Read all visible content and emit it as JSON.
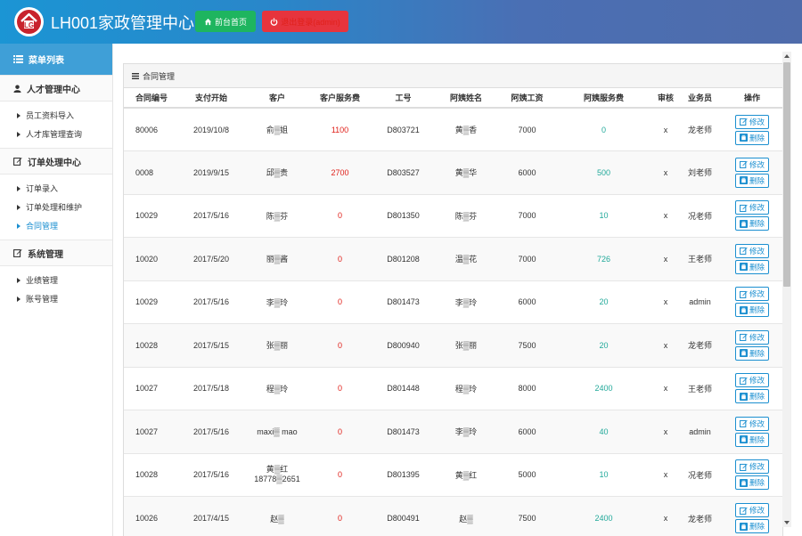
{
  "header": {
    "title": "LH001家政管理中心",
    "home_button": "前台首页",
    "logout_button": "退出登录(admin)"
  },
  "sidebar": {
    "menu_title": "菜单列表",
    "groups": [
      {
        "label": "人才管理中心",
        "icon": "user-icon",
        "items": [
          {
            "label": "员工资料导入",
            "active": false
          },
          {
            "label": "人才库管理查询",
            "active": false
          }
        ]
      },
      {
        "label": "订单处理中心",
        "icon": "edit-icon",
        "items": [
          {
            "label": "订单录入",
            "active": false
          },
          {
            "label": "订单处理和维护",
            "active": false
          },
          {
            "label": "合同管理",
            "active": true
          }
        ]
      },
      {
        "label": "系统管理",
        "icon": "edit-icon",
        "items": [
          {
            "label": "业绩管理",
            "active": false
          },
          {
            "label": "账号管理",
            "active": false
          }
        ]
      }
    ]
  },
  "panel": {
    "title": "合同管理",
    "columns": [
      "合同编号",
      "支付开始",
      "客户",
      "客户服务费",
      "工号",
      "阿姨姓名",
      "阿姨工资",
      "阿姨服务费",
      "审核",
      "业务员",
      "操作"
    ],
    "edit_label": "修改",
    "delete_label": "删除",
    "rows": [
      {
        "id": "80006",
        "start": "2019/10/8",
        "customer": "俞▒姐",
        "customer_phone": "",
        "cust_fee": "1100",
        "emp_no": "D803721",
        "aunt": "黄▒香",
        "wage": "7000",
        "aunt_fee": "0",
        "review": "x",
        "sales": "龙老师"
      },
      {
        "id": "0008",
        "start": "2019/9/15",
        "customer": "邱▒贵",
        "customer_phone": "",
        "cust_fee": "2700",
        "emp_no": "D803527",
        "aunt": "黄▒华",
        "wage": "6000",
        "aunt_fee": "500",
        "review": "x",
        "sales": "刘老师"
      },
      {
        "id": "10029",
        "start": "2017/5/16",
        "customer": "陈▒芬",
        "customer_phone": "",
        "cust_fee": "0",
        "emp_no": "D801350",
        "aunt": "陈▒芬",
        "wage": "7000",
        "aunt_fee": "10",
        "review": "x",
        "sales": "况老师"
      },
      {
        "id": "10020",
        "start": "2017/5/20",
        "customer": "丽▒酱",
        "customer_phone": "",
        "cust_fee": "0",
        "emp_no": "D801208",
        "aunt": "温▒花",
        "wage": "7000",
        "aunt_fee": "726",
        "review": "x",
        "sales": "王老师"
      },
      {
        "id": "10029",
        "start": "2017/5/16",
        "customer": "李▒玲",
        "customer_phone": "",
        "cust_fee": "0",
        "emp_no": "D801473",
        "aunt": "李▒玲",
        "wage": "6000",
        "aunt_fee": "20",
        "review": "x",
        "sales": "admin"
      },
      {
        "id": "10028",
        "start": "2017/5/15",
        "customer": "张▒丽",
        "customer_phone": "",
        "cust_fee": "0",
        "emp_no": "D800940",
        "aunt": "张▒丽",
        "wage": "7500",
        "aunt_fee": "20",
        "review": "x",
        "sales": "龙老师"
      },
      {
        "id": "10027",
        "start": "2017/5/18",
        "customer": "程▒玲",
        "customer_phone": "",
        "cust_fee": "0",
        "emp_no": "D801448",
        "aunt": "程▒玲",
        "wage": "8000",
        "aunt_fee": "2400",
        "review": "x",
        "sales": "王老师"
      },
      {
        "id": "10027",
        "start": "2017/5/16",
        "customer": "maxi▒ mao",
        "customer_phone": "",
        "cust_fee": "0",
        "emp_no": "D801473",
        "aunt": "李▒玲",
        "wage": "6000",
        "aunt_fee": "40",
        "review": "x",
        "sales": "admin"
      },
      {
        "id": "10028",
        "start": "2017/5/16",
        "customer": "黄▒红",
        "customer_phone": "18778▒2651",
        "cust_fee": "0",
        "emp_no": "D801395",
        "aunt": "黄▒红",
        "wage": "5000",
        "aunt_fee": "10",
        "review": "x",
        "sales": "况老师"
      },
      {
        "id": "10026",
        "start": "2017/4/15",
        "customer": "赵▒",
        "customer_phone": "",
        "cust_fee": "0",
        "emp_no": "D800491",
        "aunt": "赵▒",
        "wage": "7500",
        "aunt_fee": "2400",
        "review": "x",
        "sales": "龙老师"
      }
    ]
  },
  "colors": {
    "accent": "#1b8fd0",
    "header_green": "#1eb55f",
    "header_red": "#e7343d",
    "fee_red": "#e0211b",
    "fee_teal": "#22a99a"
  }
}
